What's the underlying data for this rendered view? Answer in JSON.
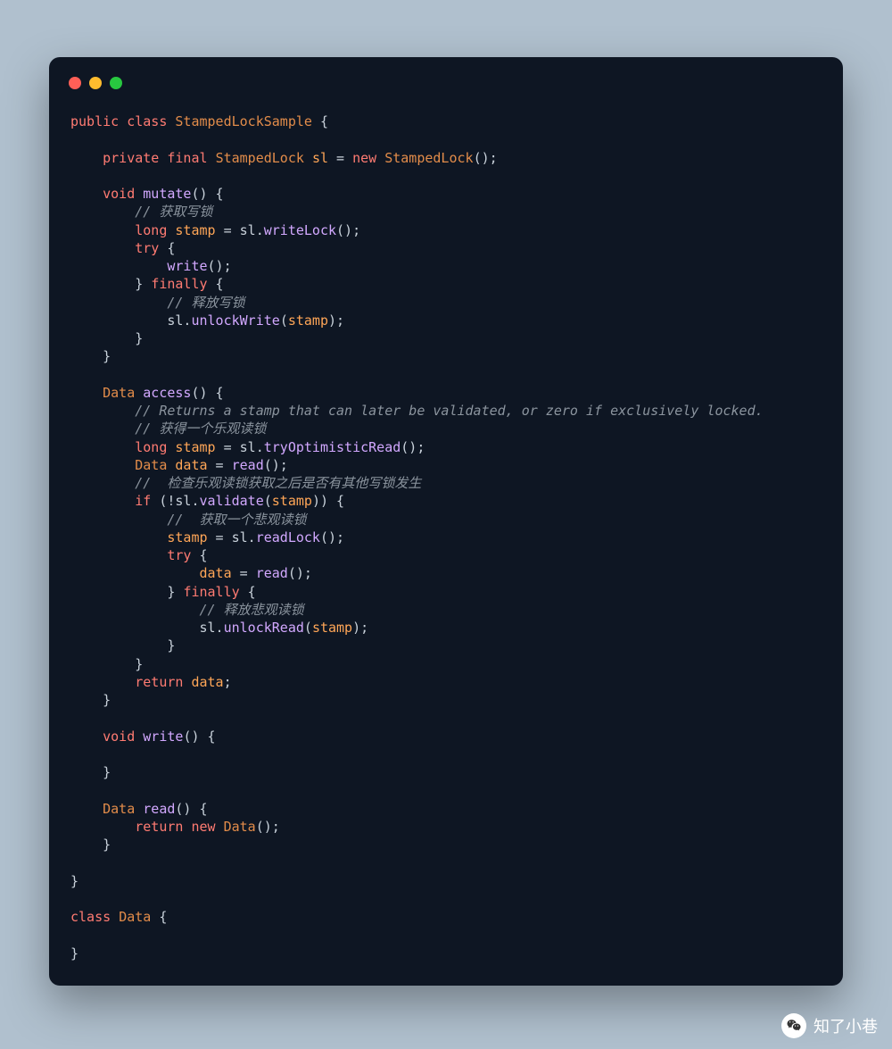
{
  "colors": {
    "page_bg": "#b0c0ce",
    "window_bg": "#0e1623",
    "traffic_red": "#ff5f57",
    "traffic_yellow": "#febc2e",
    "traffic_green": "#28c840",
    "syntax_keyword": "#ff7b72",
    "syntax_type": "#e28c4a",
    "syntax_function": "#d2a8ff",
    "syntax_variable": "#ffa657",
    "syntax_comment": "#8b949e",
    "syntax_plain": "#c9d2db"
  },
  "code": {
    "lines": [
      [
        [
          "kw",
          "public"
        ],
        [
          "pln",
          " "
        ],
        [
          "kw",
          "class"
        ],
        [
          "pln",
          " "
        ],
        [
          "type",
          "StampedLockSample"
        ],
        [
          "pln",
          " {"
        ]
      ],
      [],
      [
        [
          "pln",
          "    "
        ],
        [
          "kw",
          "private"
        ],
        [
          "pln",
          " "
        ],
        [
          "kw",
          "final"
        ],
        [
          "pln",
          " "
        ],
        [
          "type",
          "StampedLock"
        ],
        [
          "pln",
          " "
        ],
        [
          "var",
          "sl"
        ],
        [
          "pln",
          " = "
        ],
        [
          "kw",
          "new"
        ],
        [
          "pln",
          " "
        ],
        [
          "type",
          "StampedLock"
        ],
        [
          "pln",
          "();"
        ]
      ],
      [],
      [
        [
          "pln",
          "    "
        ],
        [
          "kw",
          "void"
        ],
        [
          "pln",
          " "
        ],
        [
          "fn",
          "mutate"
        ],
        [
          "pln",
          "() {"
        ]
      ],
      [
        [
          "pln",
          "        "
        ],
        [
          "cmt",
          "// 获取写锁"
        ]
      ],
      [
        [
          "pln",
          "        "
        ],
        [
          "kw",
          "long"
        ],
        [
          "pln",
          " "
        ],
        [
          "var",
          "stamp"
        ],
        [
          "pln",
          " = sl."
        ],
        [
          "fn",
          "writeLock"
        ],
        [
          "pln",
          "();"
        ]
      ],
      [
        [
          "pln",
          "        "
        ],
        [
          "kw",
          "try"
        ],
        [
          "pln",
          " {"
        ]
      ],
      [
        [
          "pln",
          "            "
        ],
        [
          "fn",
          "write"
        ],
        [
          "pln",
          "();"
        ]
      ],
      [
        [
          "pln",
          "        } "
        ],
        [
          "kw",
          "finally"
        ],
        [
          "pln",
          " {"
        ]
      ],
      [
        [
          "pln",
          "            "
        ],
        [
          "cmt",
          "// 释放写锁"
        ]
      ],
      [
        [
          "pln",
          "            sl."
        ],
        [
          "fn",
          "unlockWrite"
        ],
        [
          "pln",
          "("
        ],
        [
          "var",
          "stamp"
        ],
        [
          "pln",
          ");"
        ]
      ],
      [
        [
          "pln",
          "        }"
        ]
      ],
      [
        [
          "pln",
          "    }"
        ]
      ],
      [],
      [
        [
          "pln",
          "    "
        ],
        [
          "type",
          "Data"
        ],
        [
          "pln",
          " "
        ],
        [
          "fn",
          "access"
        ],
        [
          "pln",
          "() {"
        ]
      ],
      [
        [
          "pln",
          "        "
        ],
        [
          "cmt",
          "// Returns a stamp that can later be validated, or zero if exclusively locked."
        ]
      ],
      [
        [
          "pln",
          "        "
        ],
        [
          "cmt",
          "// 获得一个乐观读锁"
        ]
      ],
      [
        [
          "pln",
          "        "
        ],
        [
          "kw",
          "long"
        ],
        [
          "pln",
          " "
        ],
        [
          "var",
          "stamp"
        ],
        [
          "pln",
          " = sl."
        ],
        [
          "fn",
          "tryOptimisticRead"
        ],
        [
          "pln",
          "();"
        ]
      ],
      [
        [
          "pln",
          "        "
        ],
        [
          "type",
          "Data"
        ],
        [
          "pln",
          " "
        ],
        [
          "var",
          "data"
        ],
        [
          "pln",
          " = "
        ],
        [
          "fn",
          "read"
        ],
        [
          "pln",
          "();"
        ]
      ],
      [
        [
          "pln",
          "        "
        ],
        [
          "cmt",
          "//  检查乐观读锁获取之后是否有其他写锁发生"
        ]
      ],
      [
        [
          "pln",
          "        "
        ],
        [
          "kw",
          "if"
        ],
        [
          "pln",
          " (!sl."
        ],
        [
          "fn",
          "validate"
        ],
        [
          "pln",
          "("
        ],
        [
          "var",
          "stamp"
        ],
        [
          "pln",
          ")) {"
        ]
      ],
      [
        [
          "pln",
          "            "
        ],
        [
          "cmt",
          "//  获取一个悲观读锁"
        ]
      ],
      [
        [
          "pln",
          "            "
        ],
        [
          "var",
          "stamp"
        ],
        [
          "pln",
          " = sl."
        ],
        [
          "fn",
          "readLock"
        ],
        [
          "pln",
          "();"
        ]
      ],
      [
        [
          "pln",
          "            "
        ],
        [
          "kw",
          "try"
        ],
        [
          "pln",
          " {"
        ]
      ],
      [
        [
          "pln",
          "                "
        ],
        [
          "var",
          "data"
        ],
        [
          "pln",
          " = "
        ],
        [
          "fn",
          "read"
        ],
        [
          "pln",
          "();"
        ]
      ],
      [
        [
          "pln",
          "            } "
        ],
        [
          "kw",
          "finally"
        ],
        [
          "pln",
          " {"
        ]
      ],
      [
        [
          "pln",
          "                "
        ],
        [
          "cmt",
          "// 释放悲观读锁"
        ]
      ],
      [
        [
          "pln",
          "                sl."
        ],
        [
          "fn",
          "unlockRead"
        ],
        [
          "pln",
          "("
        ],
        [
          "var",
          "stamp"
        ],
        [
          "pln",
          ");"
        ]
      ],
      [
        [
          "pln",
          "            }"
        ]
      ],
      [
        [
          "pln",
          "        }"
        ]
      ],
      [
        [
          "pln",
          "        "
        ],
        [
          "kw",
          "return"
        ],
        [
          "pln",
          " "
        ],
        [
          "var",
          "data"
        ],
        [
          "pln",
          ";"
        ]
      ],
      [
        [
          "pln",
          "    }"
        ]
      ],
      [],
      [
        [
          "pln",
          "    "
        ],
        [
          "kw",
          "void"
        ],
        [
          "pln",
          " "
        ],
        [
          "fn",
          "write"
        ],
        [
          "pln",
          "() {"
        ]
      ],
      [],
      [
        [
          "pln",
          "    }"
        ]
      ],
      [],
      [
        [
          "pln",
          "    "
        ],
        [
          "type",
          "Data"
        ],
        [
          "pln",
          " "
        ],
        [
          "fn",
          "read"
        ],
        [
          "pln",
          "() {"
        ]
      ],
      [
        [
          "pln",
          "        "
        ],
        [
          "kw",
          "return"
        ],
        [
          "pln",
          " "
        ],
        [
          "kw",
          "new"
        ],
        [
          "pln",
          " "
        ],
        [
          "type",
          "Data"
        ],
        [
          "pln",
          "();"
        ]
      ],
      [
        [
          "pln",
          "    }"
        ]
      ],
      [],
      [
        [
          "pln",
          "}"
        ]
      ],
      [],
      [
        [
          "kw",
          "class"
        ],
        [
          "pln",
          " "
        ],
        [
          "type",
          "Data"
        ],
        [
          "pln",
          " {"
        ]
      ],
      [],
      [
        [
          "pln",
          "}"
        ]
      ]
    ]
  },
  "watermark": {
    "icon_name": "wechat-icon",
    "label": "知了小巷"
  }
}
